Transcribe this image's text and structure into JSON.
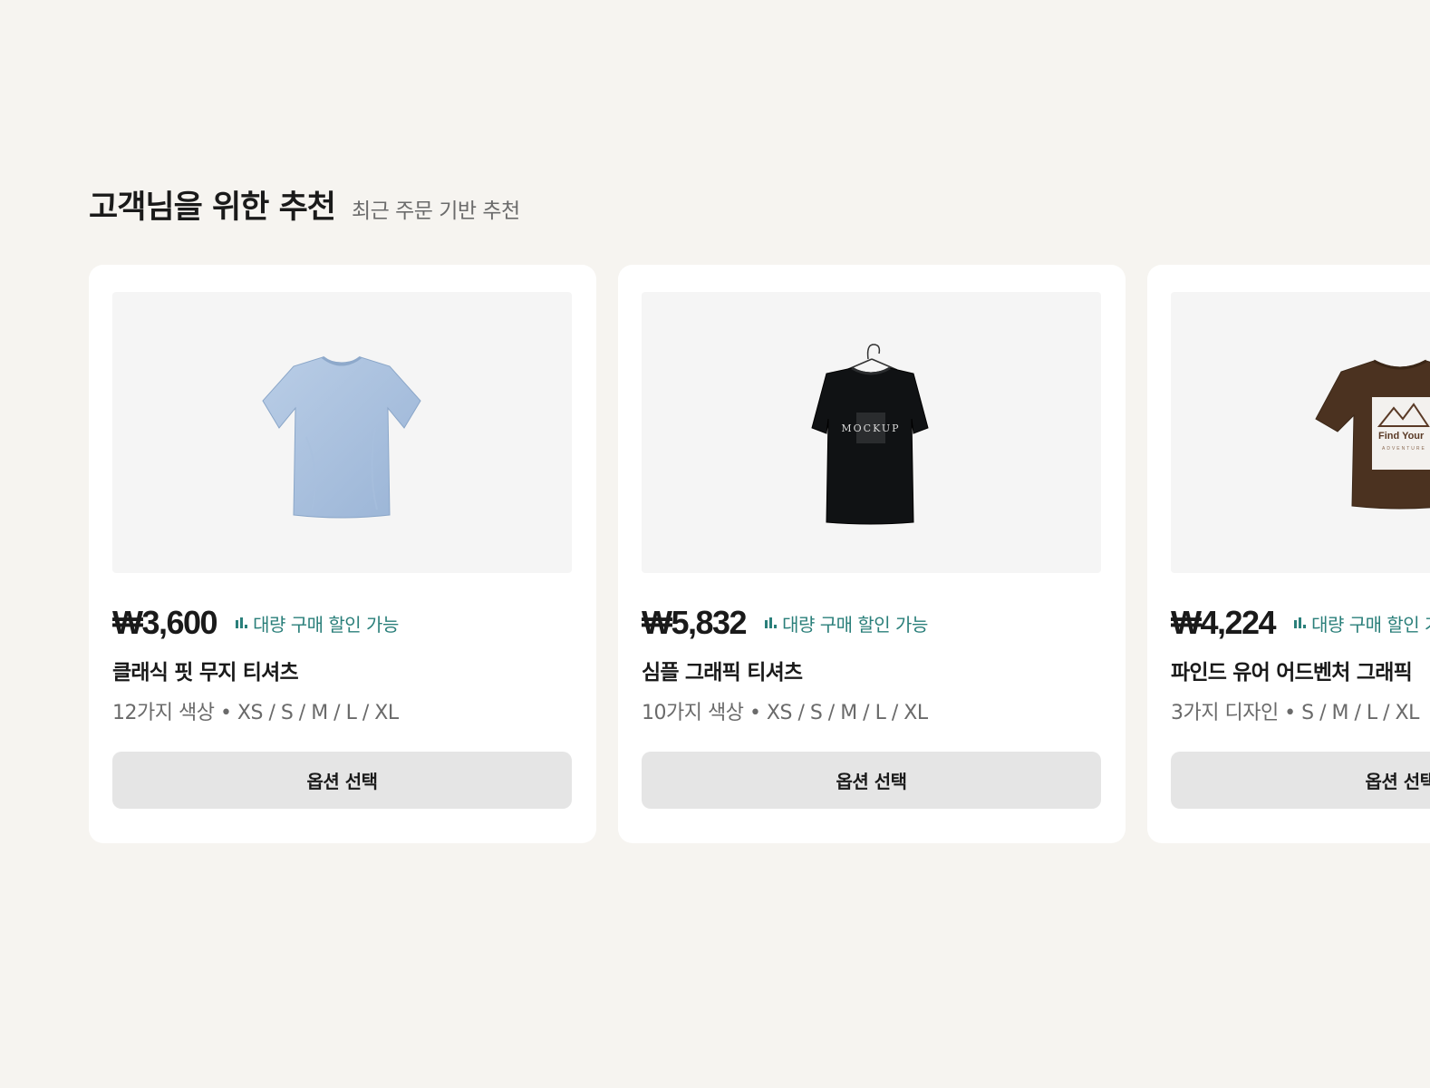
{
  "section": {
    "title": "고객님을 위한 추천",
    "subtitle": "최근 주문 기반 추천"
  },
  "colors": {
    "background": "#f6f4f0",
    "card": "#ffffff",
    "accent_teal": "#2a7f7a",
    "button_bg": "#e5e5e5"
  },
  "products": [
    {
      "price": "₩3,600",
      "badge": "대량 구매 할인 가능",
      "badge_icon": "bar-chart-icon",
      "name": "클래식 핏 무지 티셔츠",
      "meta": "12가지 색상 • XS / S / M / L / XL",
      "button": "옵션 선택",
      "image": "light-blue-tshirt"
    },
    {
      "price": "₩5,832",
      "badge": "대량 구매 할인 가능",
      "badge_icon": "bar-chart-icon",
      "name": "심플 그래픽 티셔츠",
      "meta": "10가지 색상 • XS / S / M / L / XL",
      "button": "옵션 선택",
      "image": "black-tshirt-on-hanger",
      "image_text": "MOCKUP"
    },
    {
      "price": "₩4,224",
      "badge": "대량 구매 할인 가능",
      "badge_icon": "bar-chart-icon",
      "name": "파인드 유어 어드벤처 그래픽",
      "meta": "3가지 디자인 • S / M / L / XL",
      "button": "옵션 선택",
      "image": "brown-adventure-tshirt",
      "image_text": "Find Your",
      "image_subtext": "ADVENTURE"
    }
  ]
}
